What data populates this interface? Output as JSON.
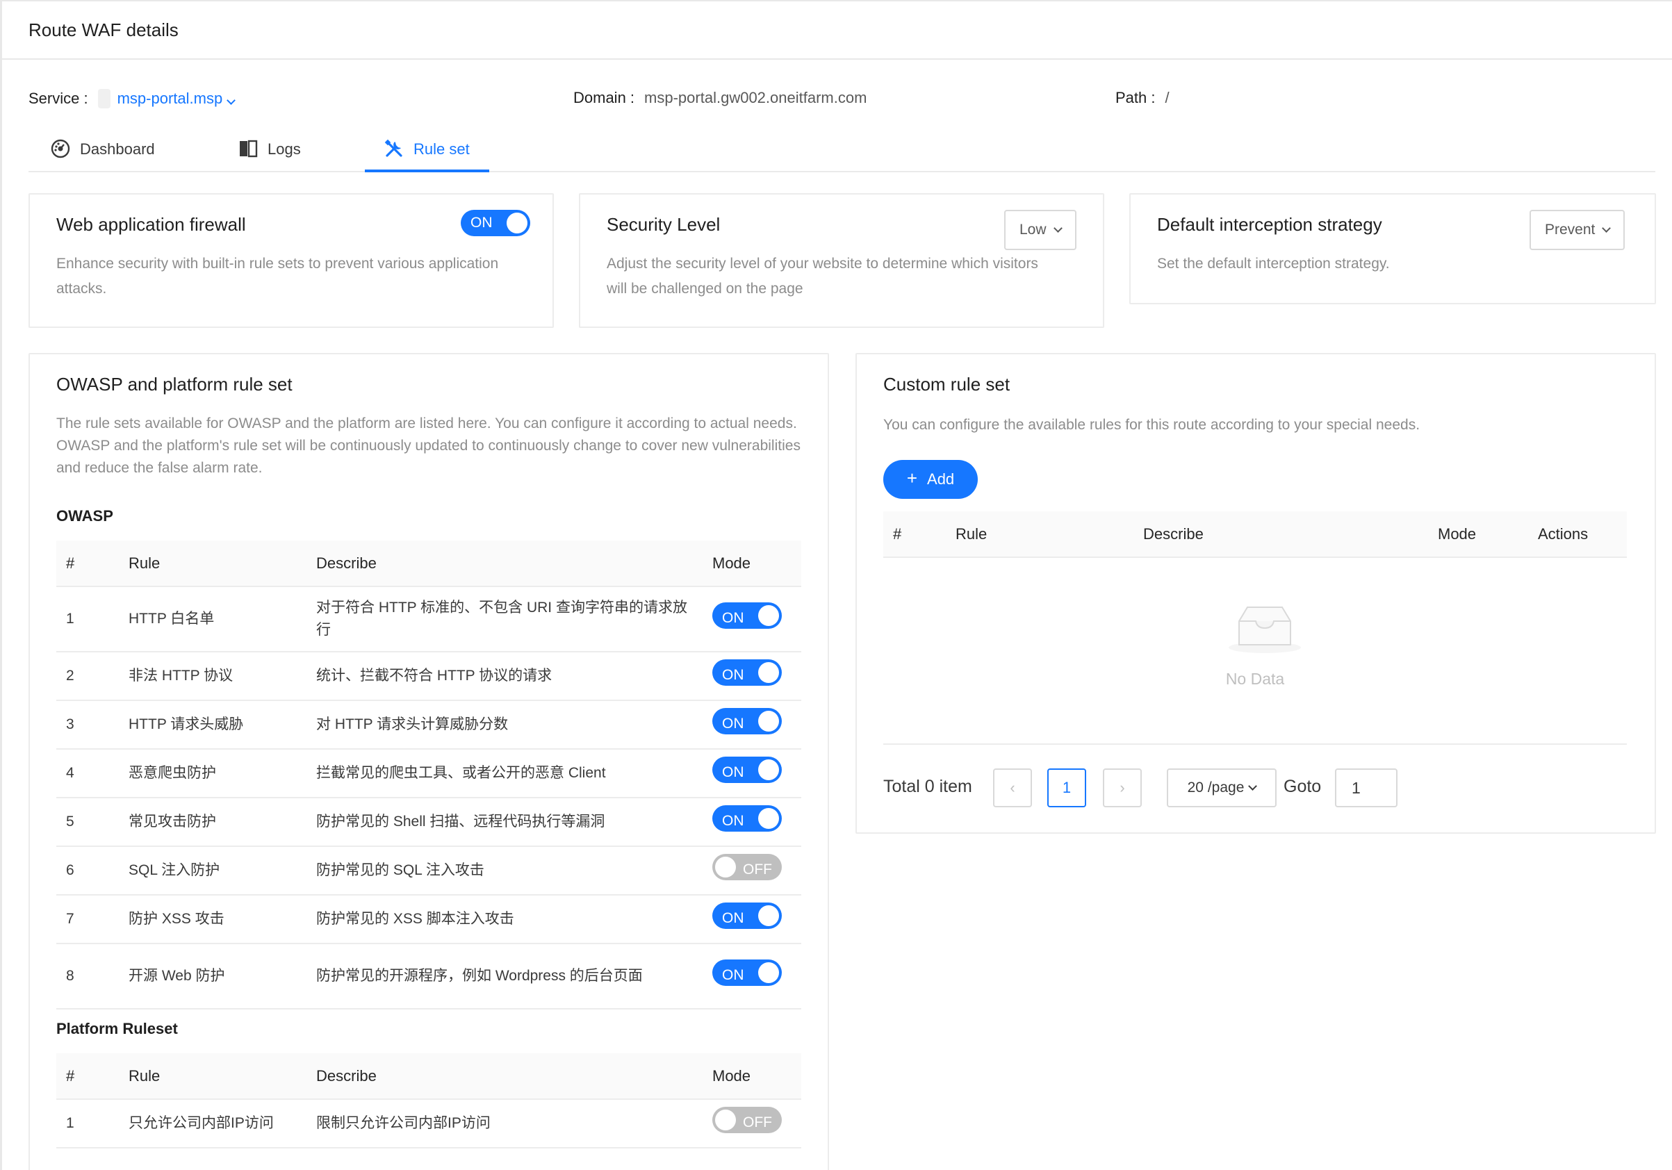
{
  "header": {
    "title": "Route WAF details"
  },
  "meta": {
    "service_label": "Service :",
    "service_value": "msp-portal.msp",
    "domain_label": "Domain :",
    "domain_value": "msp-portal.gw002.oneitfarm.com",
    "path_label": "Path :",
    "path_value": "/"
  },
  "tabs": [
    {
      "label": "Dashboard",
      "icon": "dashboard-icon"
    },
    {
      "label": "Logs",
      "icon": "book-icon"
    },
    {
      "label": "Rule set",
      "icon": "tools-icon",
      "active": true
    }
  ],
  "waf": {
    "title": "Web application firewall",
    "description": "Enhance security with built-in rule sets to prevent various application attacks.",
    "switch": "ON"
  },
  "security": {
    "title": "Security Level",
    "description": "Adjust the security level of your website to determine which visitors will be challenged on the page",
    "value": "Low"
  },
  "interception": {
    "title": "Default interception strategy",
    "description": "Set the default interception strategy.",
    "value": "Prevent"
  },
  "owasp_card": {
    "title": "OWASP and platform rule set",
    "description": "The rule sets available for OWASP and the platform are listed here. You can configure it according to actual needs. OWASP and the platform's rule set will be continuously updated to continuously change to cover new vulnerabilities and reduce the false alarm rate.",
    "owasp_heading": "OWASP",
    "platform_heading": "Platform Ruleset",
    "columns": {
      "num": "#",
      "rule": "Rule",
      "describe": "Describe",
      "mode": "Mode"
    },
    "owasp_rows": [
      {
        "num": "1",
        "rule": "HTTP 白名单",
        "describe": "对于符合 HTTP 标准的、不包含 URI 查询字符串的请求放行",
        "mode": "ON"
      },
      {
        "num": "2",
        "rule": "非法 HTTP 协议",
        "describe": "统计、拦截不符合 HTTP 协议的请求",
        "mode": "ON"
      },
      {
        "num": "3",
        "rule": "HTTP 请求头威胁",
        "describe": "对 HTTP 请求头计算威胁分数",
        "mode": "ON"
      },
      {
        "num": "4",
        "rule": "恶意爬虫防护",
        "describe": "拦截常见的爬虫工具、或者公开的恶意 Client",
        "mode": "ON"
      },
      {
        "num": "5",
        "rule": "常见攻击防护",
        "describe": "防护常见的 Shell 扫描、远程代码执行等漏洞",
        "mode": "ON"
      },
      {
        "num": "6",
        "rule": "SQL 注入防护",
        "describe": "防护常见的 SQL 注入攻击",
        "mode": "OFF"
      },
      {
        "num": "7",
        "rule": "防护 XSS 攻击",
        "describe": "防护常见的 XSS 脚本注入攻击",
        "mode": "ON"
      },
      {
        "num": "8",
        "rule": "开源 Web 防护",
        "describe": "防护常见的开源程序，例如 Wordpress 的后台页面",
        "mode": "ON"
      }
    ],
    "platform_rows": [
      {
        "num": "1",
        "rule": "只允许公司内部IP访问",
        "describe": "限制只允许公司内部IP访问",
        "mode": "OFF"
      }
    ]
  },
  "custom_card": {
    "title": "Custom rule set",
    "description": "You can configure the available rules for this route according to your special needs.",
    "add_label": "Add",
    "columns": {
      "num": "#",
      "rule": "Rule",
      "describe": "Describe",
      "mode": "Mode",
      "actions": "Actions"
    },
    "empty_text": "No Data",
    "pagination": {
      "total": "Total 0 item",
      "current_page": "1",
      "page_size": "20 /page",
      "goto_label": "Goto",
      "goto_value": "1"
    }
  },
  "colors": {
    "primary": "#1677ff",
    "off": "#bfbfbf",
    "border": "#ececec"
  }
}
